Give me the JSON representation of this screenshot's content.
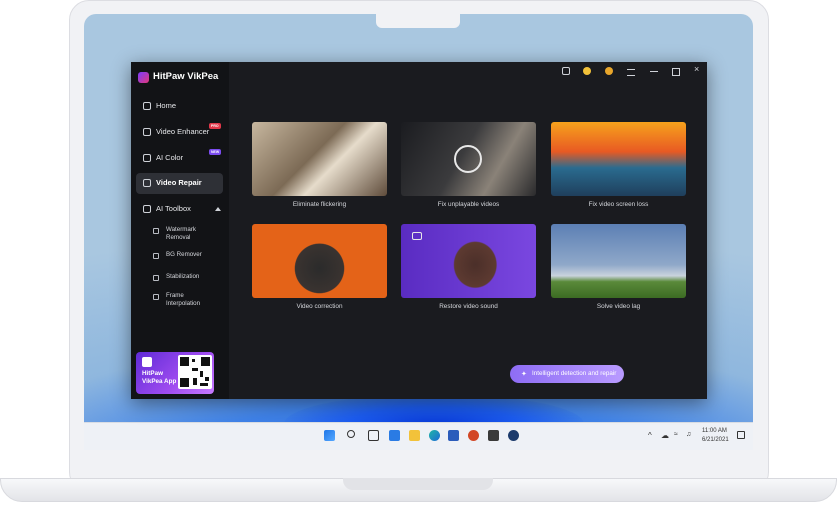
{
  "app": {
    "title": "HitPaw VikPea",
    "nav": [
      {
        "label": "Home",
        "icon": "home-icon"
      },
      {
        "label": "Video Enhancer",
        "icon": "video-enhancer-icon",
        "badge": "PRO"
      },
      {
        "label": "AI Color",
        "icon": "palette-icon",
        "badge": "NEW"
      },
      {
        "label": "Video Repair",
        "icon": "repair-icon",
        "active": true
      },
      {
        "label": "AI Toolbox",
        "icon": "toolbox-icon"
      }
    ],
    "toolbox": [
      {
        "label": "Watermark Removal",
        "icon": "eraser-icon"
      },
      {
        "label": "BG Remover",
        "icon": "bg-remover-icon"
      },
      {
        "label": "Stabilization",
        "icon": "stabilization-icon"
      },
      {
        "label": "Frame Interpolation",
        "icon": "frame-icon"
      }
    ],
    "promo": {
      "label": "HitPaw VikPea App"
    },
    "features": [
      {
        "caption": "Eliminate flickering"
      },
      {
        "caption": "Fix unplayable videos"
      },
      {
        "caption": "Fix video screen loss"
      },
      {
        "caption": "Video correction"
      },
      {
        "caption": "Restore video sound"
      },
      {
        "caption": "Solve video lag"
      }
    ],
    "cta": {
      "label": "Intelligent detection and repair"
    },
    "accent": "#8e6df5"
  },
  "taskbar": {
    "time": "11:00 AM",
    "date": "6/21/2021"
  }
}
